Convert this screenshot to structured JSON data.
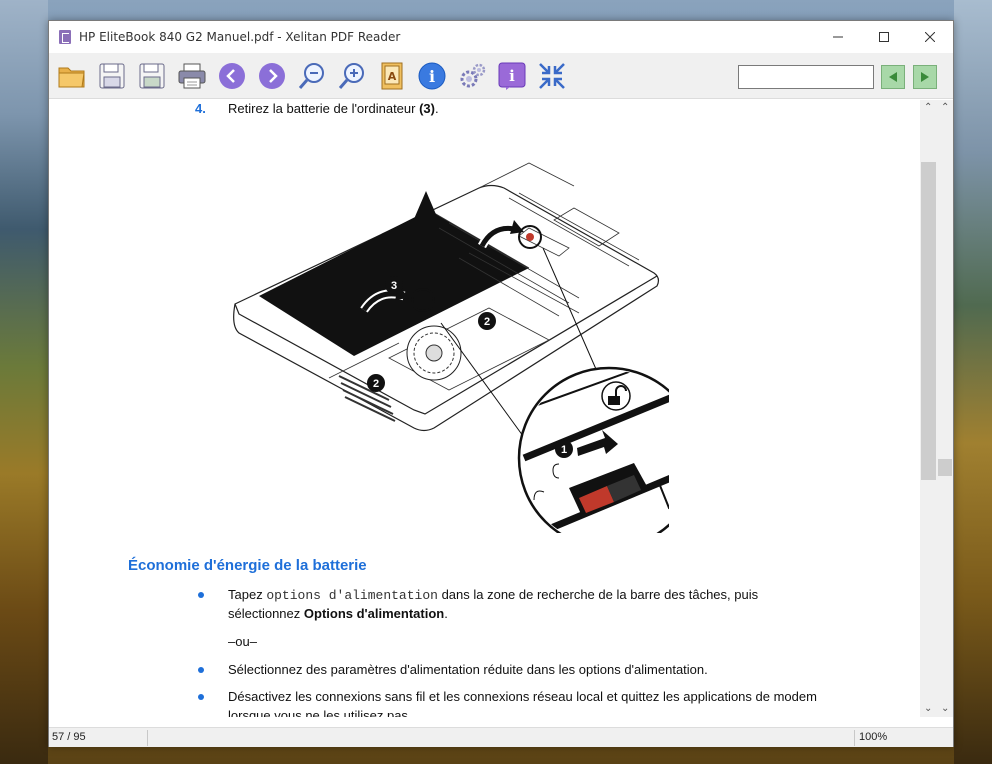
{
  "window": {
    "title": "HP EliteBook 840 G2 Manuel.pdf - Xelitan PDF Reader",
    "minimize": "—",
    "maximize": "☐",
    "close": "✕"
  },
  "toolbar": {
    "buttons": [
      {
        "name": "open-folder-button",
        "icon": "folder-icon"
      },
      {
        "name": "save-button",
        "icon": "floppy-icon"
      },
      {
        "name": "save-as-button",
        "icon": "floppy-icon"
      },
      {
        "name": "print-button",
        "icon": "printer-icon"
      },
      {
        "name": "prev-page-button",
        "icon": "chevron-left-icon"
      },
      {
        "name": "next-page-button",
        "icon": "chevron-right-icon"
      },
      {
        "name": "zoom-out-button",
        "icon": "zoom-out-icon"
      },
      {
        "name": "zoom-in-button",
        "icon": "zoom-in-icon"
      },
      {
        "name": "bookmark-button",
        "icon": "book-icon"
      },
      {
        "name": "info-button",
        "icon": "info-icon"
      },
      {
        "name": "settings-button",
        "icon": "gear-icon"
      },
      {
        "name": "document-info-button",
        "icon": "info-square-icon"
      },
      {
        "name": "fit-button",
        "icon": "collapse-icon"
      }
    ],
    "search_value": "",
    "find_prev": "◀",
    "find_next": "▶"
  },
  "document": {
    "step_number": "4.",
    "step_text_a": "Retirez la batterie de l'ordinateur ",
    "step_text_b": "(3)",
    "step_text_c": ".",
    "figure": {
      "callouts": [
        "3",
        "2",
        "2",
        "1"
      ]
    },
    "section_title": "Économie d'énergie de la batterie",
    "bullet1_a": "Tapez ",
    "bullet1_mono": "options d'alimentation",
    "bullet1_b": " dans la zone de recherche de la barre des tâches, puis",
    "bullet1_line2_a": "sélectionnez ",
    "bullet1_line2_bold": "Options d'alimentation",
    "bullet1_line2_c": ".",
    "or_text": "–ou–",
    "bullet2": "Sélectionnez des paramètres d'alimentation réduite dans les options d'alimentation.",
    "bullet3_line1": "Désactivez les connexions sans fil et les connexions réseau local et quittez les applications de modem",
    "bullet3_line2": "lorsque vous ne les utilisez pas."
  },
  "statusbar": {
    "page": "57 / 95",
    "zoom": "100%"
  },
  "colors": {
    "accent": "#1e6fd9",
    "nav_purple": "#8b6fd8",
    "nav_green": "#a8d8a8"
  }
}
